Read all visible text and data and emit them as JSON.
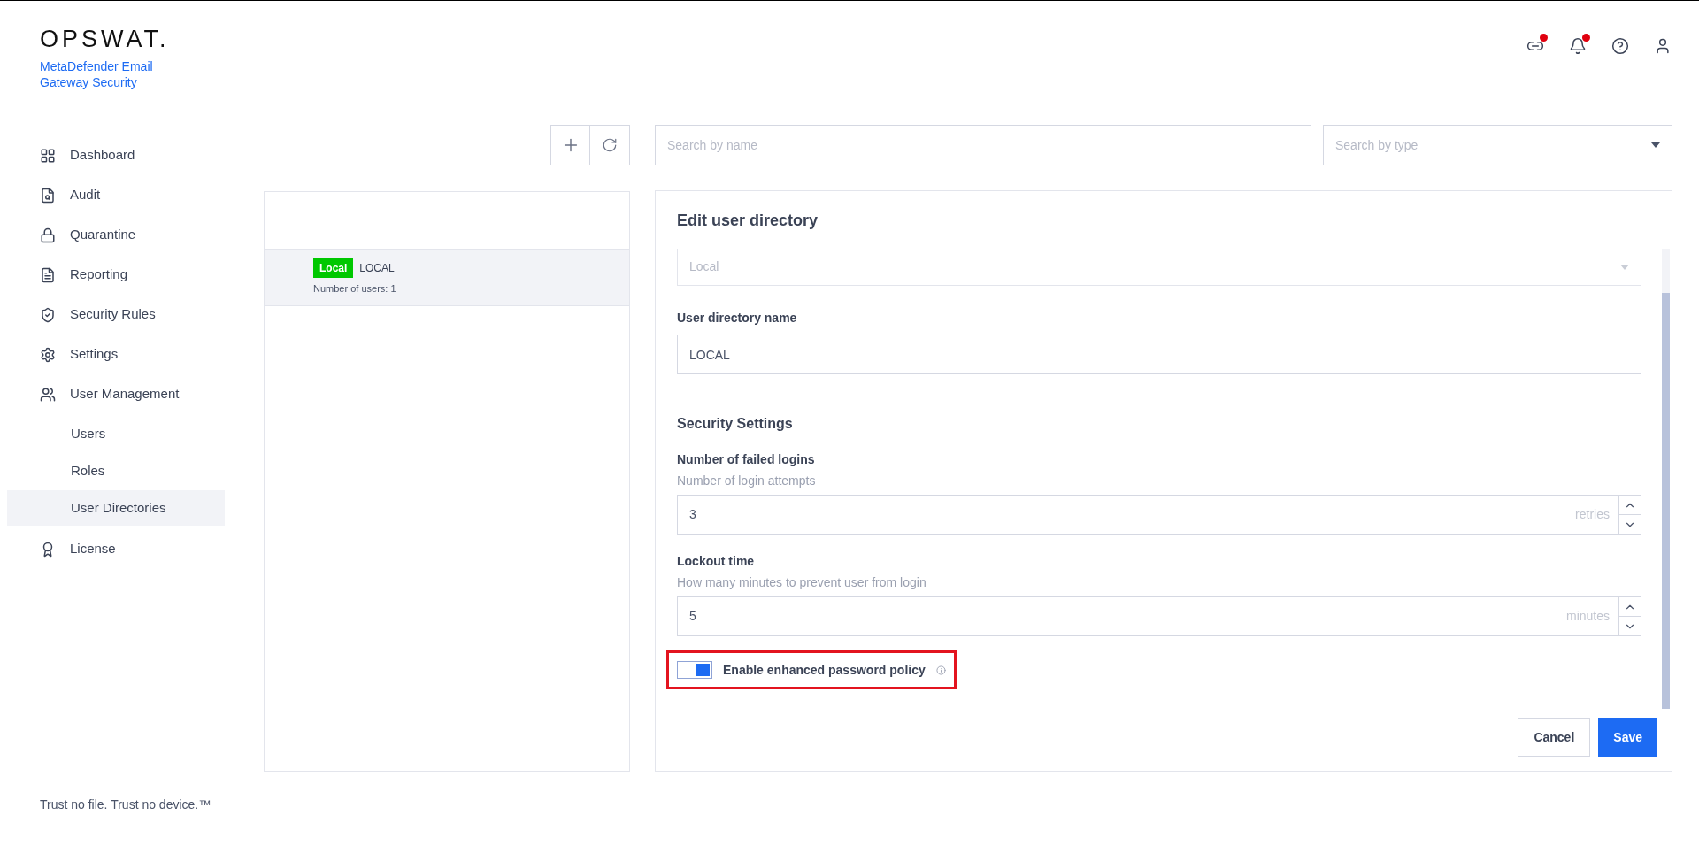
{
  "brand": {
    "logo": "OPSWAT.",
    "product": "MetaDefender Email Gateway Security"
  },
  "header_icons": [
    {
      "kind": "link",
      "alert": true
    },
    {
      "kind": "bell",
      "alert": true
    },
    {
      "kind": "help",
      "alert": false
    },
    {
      "kind": "user",
      "alert": false
    }
  ],
  "sidebar": {
    "items": [
      {
        "label": "Dashboard",
        "selected": false
      },
      {
        "label": "Audit",
        "selected": false
      },
      {
        "label": "Quarantine",
        "selected": false
      },
      {
        "label": "Reporting",
        "selected": false
      },
      {
        "label": "Security Rules",
        "selected": false
      },
      {
        "label": "Settings",
        "selected": false
      },
      {
        "label": "User Management",
        "selected": false,
        "children": [
          {
            "label": "Users",
            "selected": false
          },
          {
            "label": "Roles",
            "selected": false
          },
          {
            "label": "User Directories",
            "selected": true
          }
        ]
      },
      {
        "label": "License",
        "selected": false
      }
    ]
  },
  "filters": {
    "name": {
      "placeholder": "Search by name"
    },
    "type": {
      "placeholder": "Search by type"
    }
  },
  "directories": [
    {
      "tag": "Local",
      "name": "LOCAL",
      "detail": "Number of users: 1",
      "selected": true
    }
  ],
  "form": {
    "title": "Edit user directory",
    "type_select": {
      "value": "Local",
      "disabled": true
    },
    "name_field": {
      "label": "User directory name",
      "value": "LOCAL"
    },
    "section": "Security Settings",
    "number_fields": [
      {
        "label": "Number of failed logins",
        "hint": "Number of login attempts",
        "value": "3",
        "unit": "retries"
      },
      {
        "label": "Lockout time",
        "hint": "How many minutes to prevent user from login",
        "value": "5",
        "unit": "minutes"
      }
    ],
    "toggle": {
      "label": "Enable enhanced password policy",
      "on": true,
      "highlighted": true
    },
    "buttons": [
      {
        "kind": "secondary",
        "label": "Cancel"
      },
      {
        "kind": "primary",
        "label": "Save"
      }
    ]
  },
  "footer": "Trust no file. Trust no device.™"
}
